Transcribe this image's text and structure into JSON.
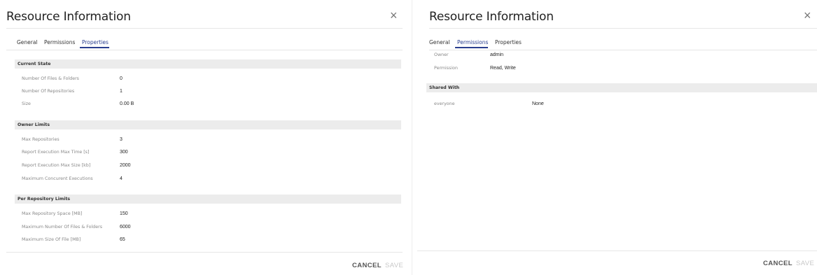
{
  "left": {
    "title": "Resource Information",
    "close_glyph": "×",
    "tabs": [
      {
        "label": "General",
        "active": false
      },
      {
        "label": "Permissions",
        "active": false
      },
      {
        "label": "Properties",
        "active": true
      }
    ],
    "sections": [
      {
        "title": "Current State",
        "rows": [
          {
            "label": "Number Of Files & Folders",
            "value": "0"
          },
          {
            "label": "Number Of Repositories",
            "value": "1"
          },
          {
            "label": "Size",
            "value": "0.00 B"
          }
        ]
      },
      {
        "title": "Owner Limits",
        "rows": [
          {
            "label": "Max Repositories",
            "value": "3"
          },
          {
            "label": "Report Execution Max Time [s]",
            "value": "300"
          },
          {
            "label": "Report Execution Max Size [kb]",
            "value": "2000"
          },
          {
            "label": "Maximum Concurent Executions",
            "value": "4"
          }
        ]
      },
      {
        "title": "Per Repository Limits",
        "rows": [
          {
            "label": "Max Repository Space [MB]",
            "value": "150"
          },
          {
            "label": "Maximum Number Of Files & Folders",
            "value": "6000"
          },
          {
            "label": "Maximum Size Of File [MB]",
            "value": "65"
          }
        ]
      }
    ],
    "cancel_label": "CANCEL",
    "save_label": "SAVE"
  },
  "right": {
    "title": "Resource Information",
    "close_glyph": "×",
    "tabs": [
      {
        "label": "General",
        "active": false
      },
      {
        "label": "Permissions",
        "active": true
      },
      {
        "label": "Properties",
        "active": false
      }
    ],
    "owner_label": "Owner",
    "owner_value": "admin",
    "permission_label": "Permission",
    "permission_value": "Read, Write",
    "shared_title": "Shared With",
    "shared_rows": [
      {
        "label": "everyone",
        "value": "None"
      }
    ],
    "cancel_label": "CANCEL",
    "save_label": "SAVE"
  },
  "colors": {
    "accent": "#2a3f8f",
    "section_bg": "#ececec",
    "label": "#888888",
    "disabled": "#c8c8c8"
  }
}
